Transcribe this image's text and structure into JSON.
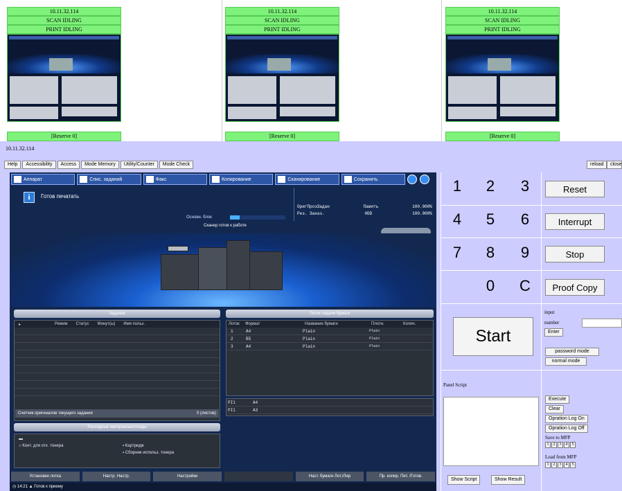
{
  "thumbnails": [
    {
      "ip": "10.11.32.114",
      "scan": "SCAN IDLING",
      "print": "PRINT IDLING",
      "reserve": "[Reserve 0]"
    },
    {
      "ip": "10.11.32.114",
      "scan": "SCAN IDLING",
      "print": "PRINT IDLING",
      "reserve": "[Reserve 0]"
    },
    {
      "ip": "10.11.32.114",
      "scan": "SCAN IDLING",
      "print": "PRINT IDLING",
      "reserve": "[Reserve 0]"
    }
  ],
  "device_ip": "10.11.32.114",
  "menu": [
    "Help",
    "Accessibility",
    "Access",
    "Mode Memory",
    "Utility/Counter",
    "Mode Check"
  ],
  "reload": "reload",
  "close": "close",
  "screen": {
    "tabs": [
      "Аппарат",
      "Спис. заданий",
      "Факс",
      "Копирование",
      "Сканирование",
      "Сохранить"
    ],
    "ready": "Готов печатать",
    "status": [
      {
        "left": "ОригПрозЗадан",
        "mid": "Память",
        "right": "100.000%"
      },
      {
        "left": "Рез. Заказ.",
        "mid": "HDD",
        "right": "100.000%"
      }
    ],
    "basic_block": "Основн. блок",
    "scanner_ready": "Сканер готов к работе",
    "jobs_title": "Задания",
    "jobs_headers": [
      "Режим",
      "Статус",
      "Минут(ы)",
      "Имя польз."
    ],
    "originals": "Счетчик оригиналов текущего задания",
    "originals_count": "0 (листов)",
    "consumables_title": "Расходные материалы/отходы",
    "consumables": [
      "Конт. для отх. тонера",
      "Картридж",
      "Сборник использ. тонера"
    ],
    "paper_title": "Лоток подачи бумаги",
    "paper_headers": [
      "Лоток",
      "Формат",
      "Название бумаги",
      "Плотн.",
      "Колич."
    ],
    "paper_rows": [
      {
        "tray": "1",
        "size": "A4",
        "name": "Plain",
        "weight": "Plain"
      },
      {
        "tray": "2",
        "size": "B5",
        "name": "Plain",
        "weight": "Plain"
      },
      {
        "tray": "3",
        "size": "A4",
        "name": "Plain",
        "weight": "Plain"
      }
    ],
    "pi_rows": [
      {
        "tray": "PI1",
        "size": "A4"
      },
      {
        "tray": "PI1",
        "size": "A3"
      }
    ],
    "footer_buttons": [
      "Установки лотка",
      "Настр. Настр.",
      "Настройки",
      "",
      "Наст. бумаги Лот./Лир",
      "Пр. копир. Пит. /Готов."
    ],
    "statusbar_time": "14:21",
    "statusbar_text": "Готов к приему"
  },
  "keypad": {
    "keys": [
      "1",
      "2",
      "3",
      "4",
      "5",
      "6",
      "7",
      "8",
      "9",
      "0",
      "C"
    ],
    "reset": "Reset",
    "interrupt": "Interrupt",
    "stop": "Stop",
    "proof_copy": "Proof Copy",
    "start": "Start",
    "input_label": "input",
    "number_label": "number",
    "enter": "Enter",
    "password_mode": "password mode",
    "normal_mode": "normal mode",
    "panel_script": "Panel Script",
    "execute": "Execute",
    "clear": "Clear",
    "op_log_on": "Opration Log On",
    "op_log_off": "Opration Log Off",
    "save_to_mfp": "Save to MFP",
    "load_from_mfp": "Load from MFP",
    "slots": [
      "1",
      "2",
      "3",
      "4",
      "5"
    ],
    "show_script": "Show Script",
    "show_result": "Show Result"
  }
}
